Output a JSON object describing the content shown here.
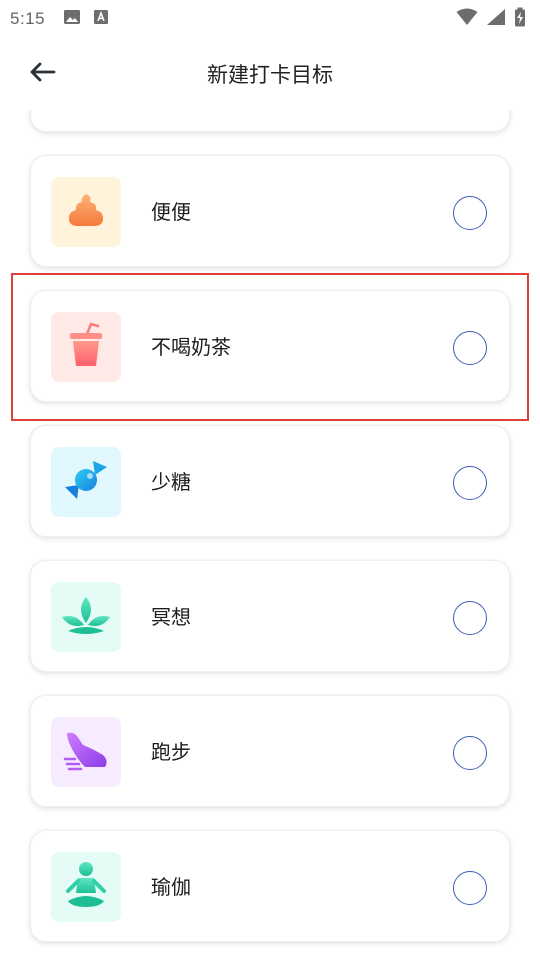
{
  "status_bar": {
    "time": "5:15",
    "icons": [
      "image-icon",
      "font-a-icon",
      "wifi-icon",
      "signal-icon",
      "battery-charging-icon"
    ]
  },
  "header": {
    "title": "新建打卡目标",
    "back_icon": "arrow-left-icon"
  },
  "goals": [
    {
      "label": "便便",
      "icon": "poop-icon",
      "tile_color": "#fff3dc",
      "selected": false
    },
    {
      "label": "不喝奶茶",
      "icon": "milk-tea-cup-icon",
      "tile_color": "#ffe9e6",
      "selected": false
    },
    {
      "label": "少糖",
      "icon": "candy-icon",
      "tile_color": "#e2f8ff",
      "selected": false
    },
    {
      "label": "冥想",
      "icon": "lotus-icon",
      "tile_color": "#e4fbf6",
      "selected": false
    },
    {
      "label": "跑步",
      "icon": "running-shoe-icon",
      "tile_color": "#f7ecff",
      "selected": false
    },
    {
      "label": "瑜伽",
      "icon": "yoga-person-icon",
      "tile_color": "#e4fbf6",
      "selected": false
    }
  ],
  "colors": {
    "radio_border": "#3d5fb4",
    "highlight": "#e0403a"
  }
}
